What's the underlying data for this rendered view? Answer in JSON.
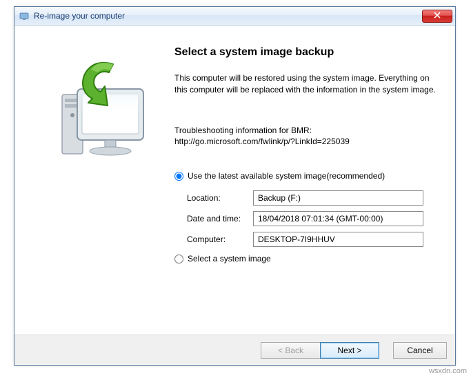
{
  "window": {
    "title": "Re-image your computer"
  },
  "heading": "Select a system image backup",
  "description": "This computer will be restored using the system image. Everything on this computer will be replaced with the information in the system image.",
  "troubleshoot_label": "Troubleshooting information for BMR:",
  "troubleshoot_link": "http://go.microsoft.com/fwlink/p/?LinkId=225039",
  "options": {
    "use_latest": "Use the latest available system image(recommended)",
    "select_image": "Select a system image"
  },
  "fields": {
    "location_label": "Location:",
    "location_value": "Backup (F:)",
    "datetime_label": "Date and time:",
    "datetime_value": "18/04/2018 07:01:34 (GMT-00:00)",
    "computer_label": "Computer:",
    "computer_value": "DESKTOP-7I9HHUV"
  },
  "buttons": {
    "back": "< Back",
    "next": "Next >",
    "cancel": "Cancel"
  },
  "watermark": "wsxdn.com"
}
